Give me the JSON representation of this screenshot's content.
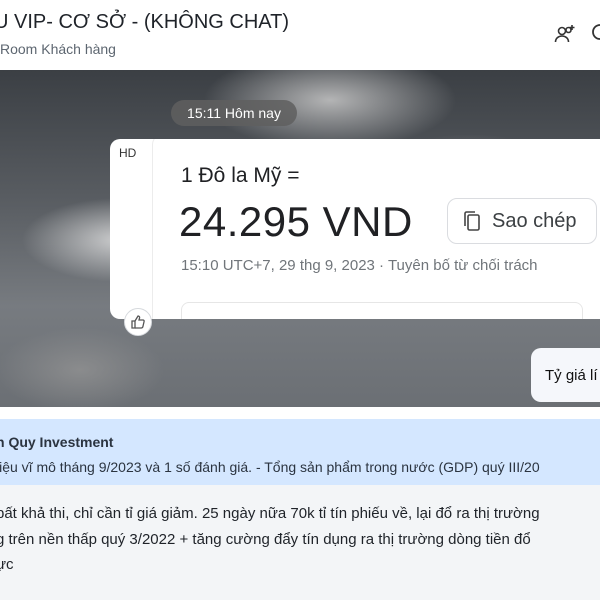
{
  "header": {
    "title": "U VIP- CƠ SỞ - (KHÔNG CHAT)",
    "subtitle": "Room Khách hàng",
    "icons": [
      "add-member-icon",
      "search-icon"
    ]
  },
  "chat": {
    "time_separator": "15:11 Hôm nay",
    "image_message": {
      "hd_label": "HD",
      "conversion_top": "1 Đô la Mỹ =",
      "conversion_value": "24.295 VND",
      "copy_label": "Sao chép",
      "meta": "15:10 UTC+7, 29 thg 9, 2023 · Tuyên bố từ chối trách"
    },
    "my_message": "Tỷ giá lí"
  },
  "quote": {
    "author": "n Quy Investment",
    "text": "liệu vĩ mô tháng 9/2023 và 1 số đánh giá. - Tổng sản phẩm trong nước (GDP) quý III/20"
  },
  "message_lines": [
    "bất khả thi, chỉ cần tỉ giá giảm. 25 ngày nữa 70k tỉ tín phiếu về, lại đổ ra thị trường",
    "g trên nền thấp quý 3/2022 + tăng cường đẩy tín dụng ra thị trường dòng tiền đổ",
    "ực"
  ]
}
